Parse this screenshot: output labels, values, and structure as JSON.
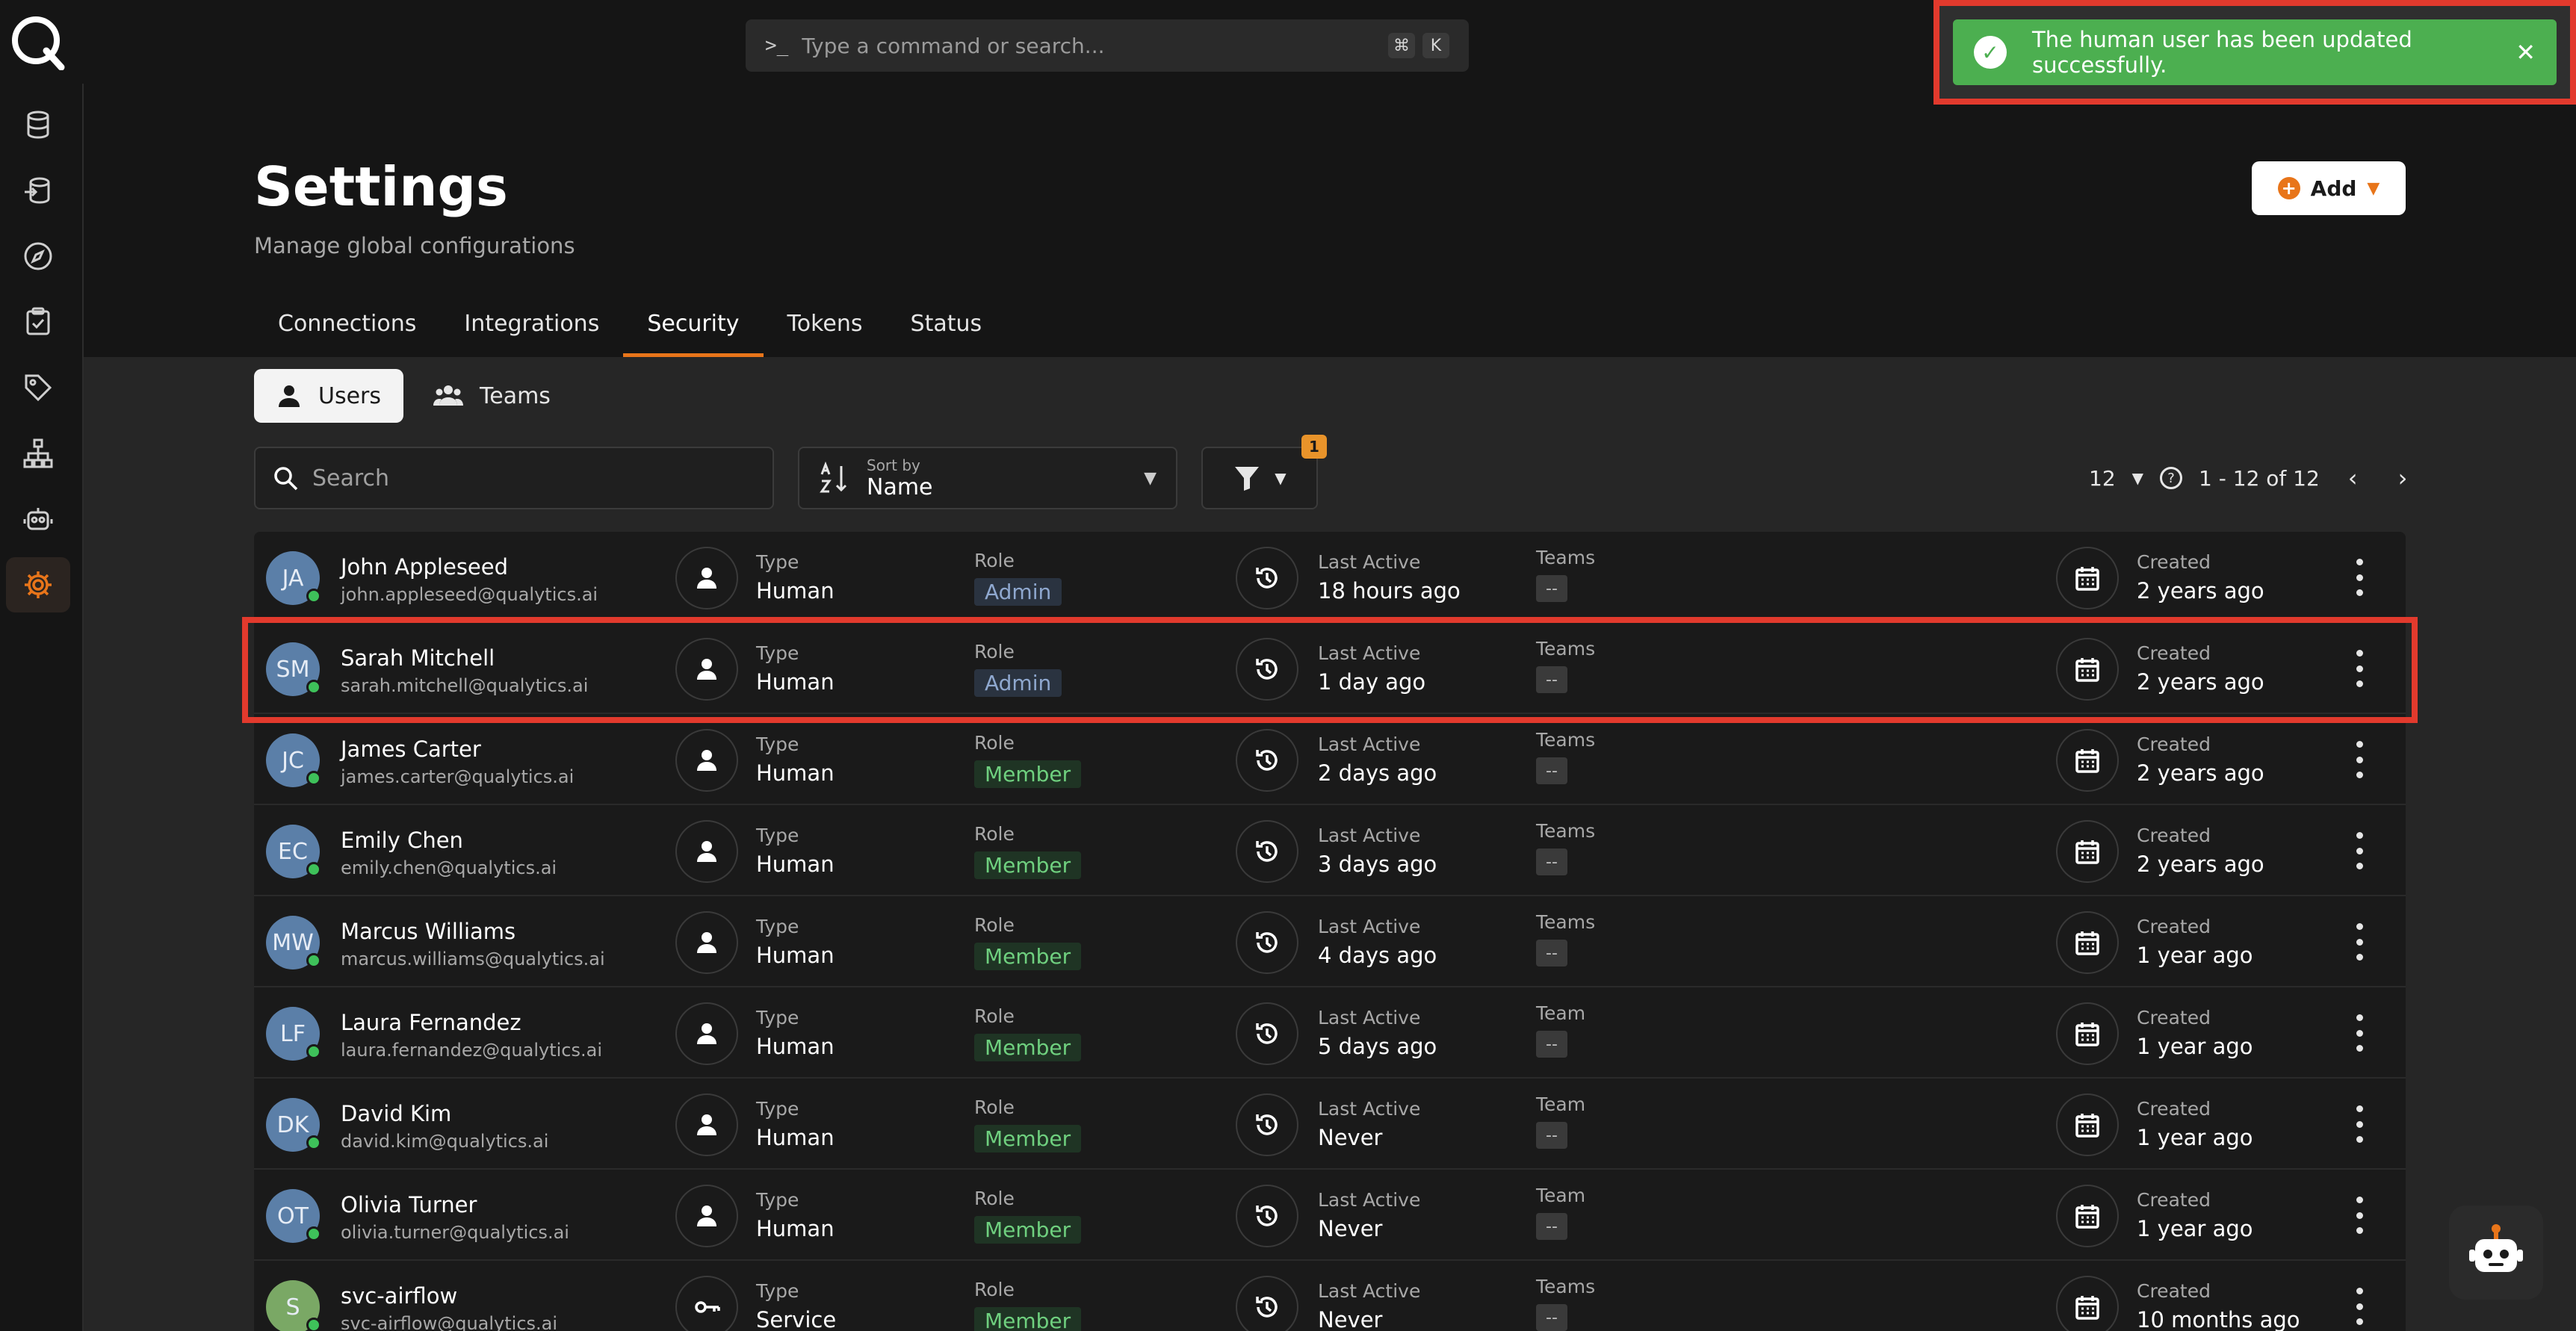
{
  "app": {
    "logo": "qualytics-logo"
  },
  "command_bar": {
    "prompt_glyph": ">_",
    "placeholder": "Type a command or search...",
    "shortcut_keys": [
      "⌘",
      "K"
    ]
  },
  "sidebar": {
    "items": [
      {
        "icon": "database-icon",
        "active": false
      },
      {
        "icon": "database-arrow-icon",
        "active": false
      },
      {
        "icon": "compass-icon",
        "active": false
      },
      {
        "icon": "clipboard-check-icon",
        "active": false
      },
      {
        "icon": "tag-icon",
        "active": false
      },
      {
        "icon": "hierarchy-icon",
        "active": false
      },
      {
        "icon": "robot-icon",
        "active": false
      },
      {
        "icon": "gear-icon",
        "active": true
      }
    ]
  },
  "page": {
    "title": "Settings",
    "subtitle": "Manage global configurations",
    "add_label": "Add"
  },
  "tabs": [
    {
      "label": "Connections",
      "active": false
    },
    {
      "label": "Integrations",
      "active": false
    },
    {
      "label": "Security",
      "active": true
    },
    {
      "label": "Tokens",
      "active": false
    },
    {
      "label": "Status",
      "active": false
    }
  ],
  "segments": {
    "users_label": "Users",
    "teams_label": "Teams",
    "active": "users"
  },
  "toolbar": {
    "search_placeholder": "Search",
    "sort_caption": "Sort by",
    "sort_value": "Name",
    "filter_count": "1"
  },
  "pagination": {
    "page_size": "12",
    "range": "1 - 12 of 12"
  },
  "column_labels": {
    "type": "Type",
    "role": "Role",
    "last_active": "Last Active",
    "created": "Created"
  },
  "users": [
    {
      "initials": "JA",
      "name": "John Appleseed",
      "email": "john.appleseed@qualytics.ai",
      "type": "Human",
      "role": "Admin",
      "last_active": "18 hours ago",
      "teams_label": "Teams",
      "teams": "--",
      "created": "2 years ago",
      "avatar_color": "#5b7fa8"
    },
    {
      "initials": "SM",
      "name": "Sarah Mitchell",
      "email": "sarah.mitchell@qualytics.ai",
      "type": "Human",
      "role": "Admin",
      "last_active": "1 day ago",
      "teams_label": "Teams",
      "teams": "--",
      "created": "2 years ago",
      "avatar_color": "#5b7fa8"
    },
    {
      "initials": "JC",
      "name": "James Carter",
      "email": "james.carter@qualytics.ai",
      "type": "Human",
      "role": "Member",
      "last_active": "2 days ago",
      "teams_label": "Teams",
      "teams": "--",
      "created": "2 years ago",
      "avatar_color": "#5b7fa8"
    },
    {
      "initials": "EC",
      "name": "Emily Chen",
      "email": "emily.chen@qualytics.ai",
      "type": "Human",
      "role": "Member",
      "last_active": "3 days ago",
      "teams_label": "Teams",
      "teams": "--",
      "created": "2 years ago",
      "avatar_color": "#5b7fa8"
    },
    {
      "initials": "MW",
      "name": "Marcus Williams",
      "email": "marcus.williams@qualytics.ai",
      "type": "Human",
      "role": "Member",
      "last_active": "4 days ago",
      "teams_label": "Teams",
      "teams": "--",
      "created": "1 year ago",
      "avatar_color": "#5b7fa8"
    },
    {
      "initials": "LF",
      "name": "Laura Fernandez",
      "email": "laura.fernandez@qualytics.ai",
      "type": "Human",
      "role": "Member",
      "last_active": "5 days ago",
      "teams_label": "Team",
      "teams": "--",
      "created": "1 year ago",
      "avatar_color": "#5b7fa8"
    },
    {
      "initials": "DK",
      "name": "David Kim",
      "email": "david.kim@qualytics.ai",
      "type": "Human",
      "role": "Member",
      "last_active": "Never",
      "teams_label": "Team",
      "teams": "--",
      "created": "1 year ago",
      "avatar_color": "#5b7fa8"
    },
    {
      "initials": "OT",
      "name": "Olivia Turner",
      "email": "olivia.turner@qualytics.ai",
      "type": "Human",
      "role": "Member",
      "last_active": "Never",
      "teams_label": "Team",
      "teams": "--",
      "created": "1 year ago",
      "avatar_color": "#5b7fa8"
    },
    {
      "initials": "S",
      "name": "svc-airflow",
      "email": "svc-airflow@qualytics.ai",
      "type": "Service",
      "role": "Member",
      "last_active": "Never",
      "teams_label": "Teams",
      "teams": "--",
      "created": "10 months ago",
      "avatar_color": "#7aa865"
    }
  ],
  "toast": {
    "message": "The human user has been updated successfully.",
    "close_glyph": "✕",
    "color": "#4caf50"
  },
  "colors": {
    "accent": "#e8751a",
    "highlight": "#e23a2d",
    "background": "#262626"
  }
}
